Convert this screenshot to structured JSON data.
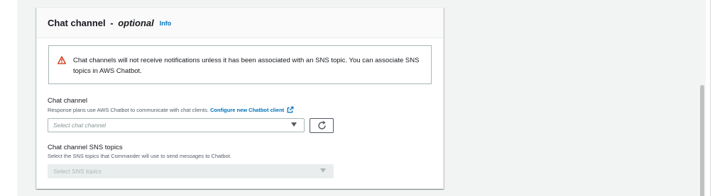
{
  "section": {
    "title": "Chat channel",
    "title_separator": "-",
    "optional_label": "optional",
    "info_link": "Info"
  },
  "alert": {
    "icon": "warning-icon",
    "icon_color": "#d13212",
    "text": "Chat channels will not receive notifications unless it has been associated with an SNS topic. You can associate SNS topics in AWS Chatbot."
  },
  "chat_channel": {
    "label": "Chat channel",
    "description": "Response plans use AWS Chatbot to communicate with chat clients.",
    "link_text": "Configure new Chatbot client",
    "link_icon": "external-link-icon",
    "placeholder": "Select chat channel",
    "refresh_icon": "refresh-icon"
  },
  "sns_topics": {
    "label": "Chat channel SNS topics",
    "description": "Select the SNS topics that Commander will use to send messages to Chatbot.",
    "placeholder": "Select SNS topics",
    "disabled": true
  },
  "colors": {
    "link": "#0073bb",
    "warning": "#d13212",
    "text": "#16191f",
    "muted": "#545b64"
  }
}
